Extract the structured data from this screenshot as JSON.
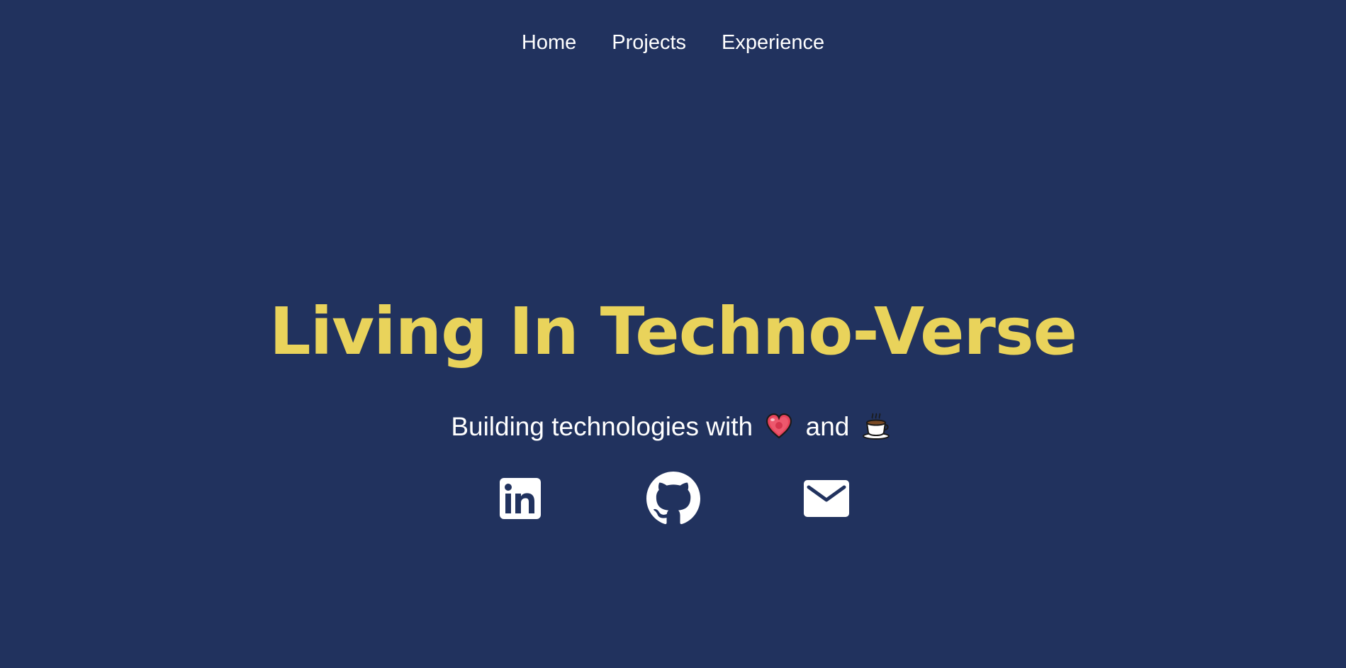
{
  "nav": {
    "items": [
      {
        "label": "Home"
      },
      {
        "label": "Projects"
      },
      {
        "label": "Experience"
      }
    ]
  },
  "hero": {
    "title": "Living In Techno-Verse",
    "subtitle_prefix": "Building technologies with",
    "subtitle_mid": "and",
    "subtitle_icons": [
      "heart-icon",
      "coffee-icon"
    ]
  },
  "socials": [
    {
      "icon": "linkedin-icon"
    },
    {
      "icon": "github-icon"
    },
    {
      "icon": "mail-icon"
    }
  ],
  "colors": {
    "background": "#21325e",
    "accent": "#e9d35b",
    "text": "#ffffff"
  }
}
